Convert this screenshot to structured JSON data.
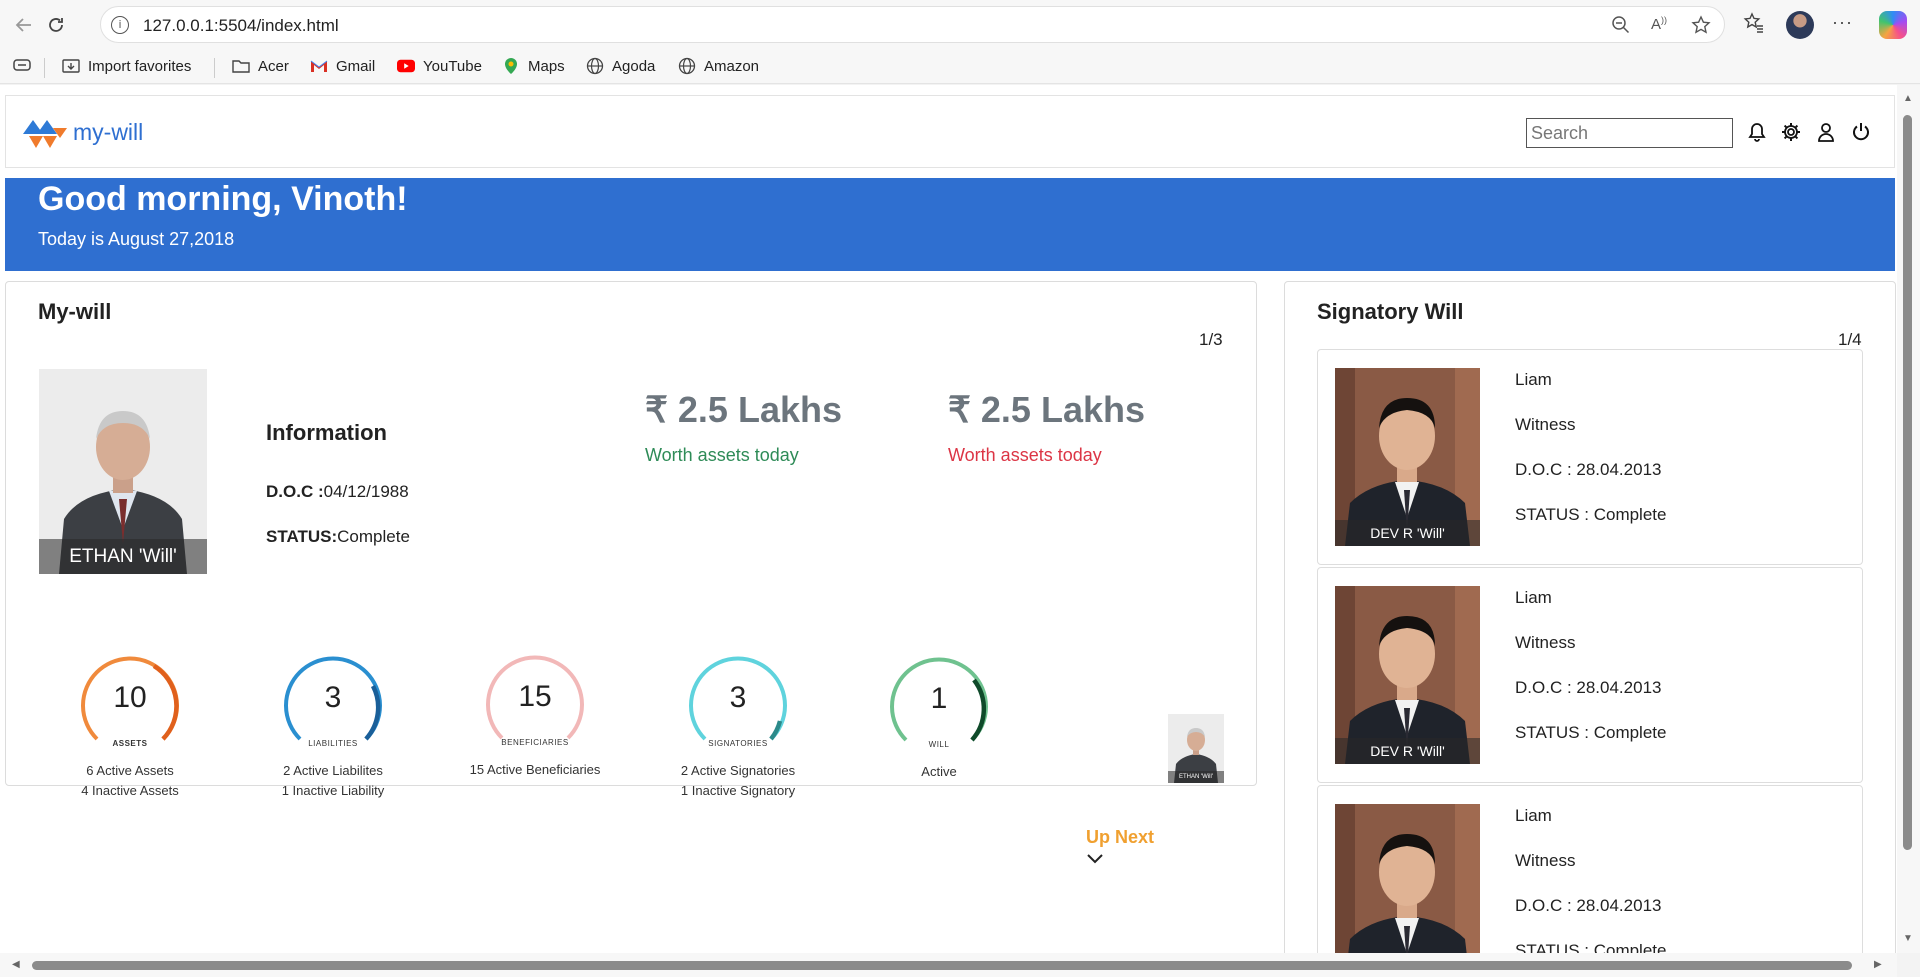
{
  "browser": {
    "url": "127.0.0.1:5504/index.html",
    "favorites": [
      {
        "label": "Import favorites",
        "icon": "import-icon"
      },
      {
        "label": "Acer",
        "icon": "folder-icon"
      },
      {
        "label": "Gmail",
        "icon": "gmail-icon"
      },
      {
        "label": "YouTube",
        "icon": "youtube-icon"
      },
      {
        "label": "Maps",
        "icon": "maps-icon"
      },
      {
        "label": "Agoda",
        "icon": "globe-icon"
      },
      {
        "label": "Amazon",
        "icon": "globe-icon"
      }
    ]
  },
  "header": {
    "logo_text": "my-will",
    "search_placeholder": "Search"
  },
  "banner": {
    "greeting": "Good morning, Vinoth!",
    "date_line": "Today is August 27,2018"
  },
  "my_will": {
    "title": "My-will",
    "pager": "1/3",
    "portrait_caption": "ETHAN 'Will'",
    "info_heading": "Information",
    "doc_label": "D.O.C :",
    "doc_value": "04/12/1988",
    "status_label": "STATUS:",
    "status_value": "Complete",
    "worth": [
      {
        "amount": "₹ 2.5 Lakhs",
        "label": "Worth assets today",
        "color": "#2e8b57"
      },
      {
        "amount": "₹ 2.5 Lakhs",
        "label": "Worth assets today",
        "color": "#dc3545"
      }
    ],
    "stats": [
      {
        "value": "10",
        "tag": "ASSETS",
        "lines": [
          "6 Active Assets",
          "4 Inactive Assets"
        ],
        "color": "#f08a3c"
      },
      {
        "value": "3",
        "tag": "LIABILITIES",
        "lines": [
          "2 Active Liabilites",
          "1 Inactive Liability"
        ],
        "color": "#2a8fd0"
      },
      {
        "value": "15",
        "tag": "BENEFICIARIES",
        "lines": [
          "15 Active Beneficiaries"
        ],
        "color": "#f2b8b8"
      },
      {
        "value": "3",
        "tag": "SIGNATORIES",
        "lines": [
          "2 Active Signatories",
          "1 Inactive Signatory"
        ],
        "color": "#5fd3dd"
      },
      {
        "value": "1",
        "tag": "WILL",
        "lines": [
          "Active"
        ],
        "color": "#6fc28f"
      }
    ],
    "up_next": "Up Next",
    "up_next_caption": "ETHAN 'Will'"
  },
  "signatory": {
    "title": "Signatory Will",
    "pager": "1/4",
    "items": [
      {
        "caption": "DEV R 'Will'",
        "name": "Liam",
        "role": "Witness",
        "doc": "D.O.C : 28.04.2013",
        "status": "STATUS : Complete"
      },
      {
        "caption": "DEV R 'Will'",
        "name": "Liam",
        "role": "Witness",
        "doc": "D.O.C : 28.04.2013",
        "status": "STATUS : Complete"
      },
      {
        "caption": "",
        "name": "Liam",
        "role": "Witness",
        "doc": "D.O.C : 28.04.2013",
        "status": "STATUS : Complete"
      }
    ]
  }
}
